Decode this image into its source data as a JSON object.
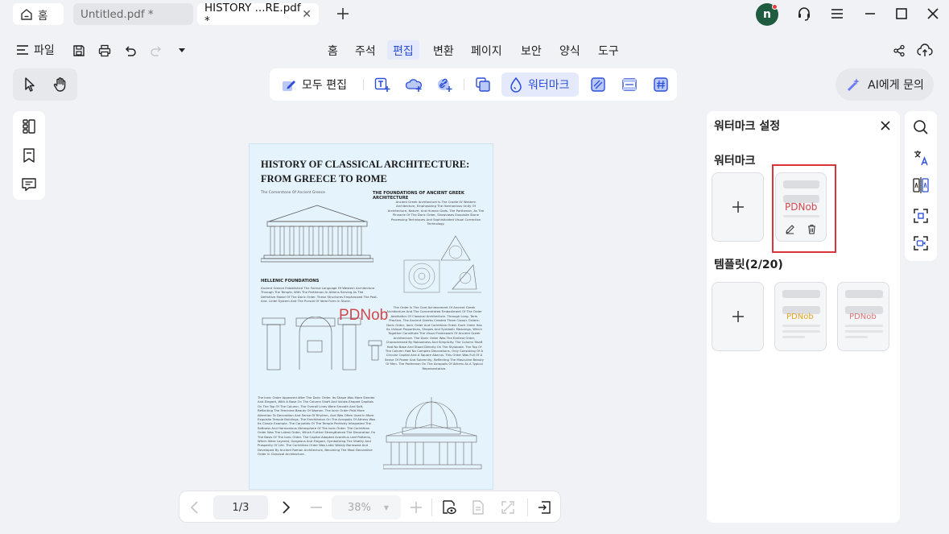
{
  "tabs": [
    {
      "label": "홈"
    },
    {
      "label": "Untitled.pdf *"
    },
    {
      "label": "HISTORY ...RE.pdf *"
    }
  ],
  "user": {
    "initial": "n"
  },
  "menu": {
    "file_label": "파일",
    "items": [
      "홈",
      "주석",
      "편집",
      "변환",
      "페이지",
      "보안",
      "양식",
      "도구"
    ],
    "active": "편집"
  },
  "edit_toolbar": {
    "edit_all_label": "모두 편집",
    "watermark_label": "워터마크"
  },
  "ai_button": {
    "label": "AI에게 문의"
  },
  "document": {
    "title": "HISTORY OF CLASSICAL  ARCHITECTURE: FROM GREECE TO ROME",
    "subtitle": "The Cornerstone Of Ancient Greece",
    "section1_heading": "THE FOUNDATIONS OF ANCIENT GREEK ARCHITECTURE",
    "section1_text": "Ancient Greek Architecture Is The Cradle Of Western Architecture, Emphasizing The Harmonious Unity Of Architecture, Nature, And Human Gods. The Parthenon, As The Pinnacle Of The Doric Order, Showcases Exquisite Stone Processing Techniques And Sophisticated Visual Correction Technology.",
    "section2_heading": "HELLENIC FOUNDATIONS",
    "section2_text": "Ancient Greece Established The Formal Language Of Western Architecture Through The Temple, With The Parthenon In Athens Serving As The Definitive Model Of The Doric Order. These Structures Emphasized The Post- And- Lintel System And The Pursuit Of Ideal Form In Stone.",
    "section3_text": "The Order Is The Core Achievement Of Ancient Greek Architecture And The Concentrated Embodiment Of The Order Aesthetics Of Classical Architecture. Through Long- Term Practice, The Ancient Greeks Created Three Classic Orders: Doric Order, Ionic Order And Corinthian Order. Each Order Has Its Unique Proportions, Shapes And Symbolic Meanings, Which Together Constitute The Visual Framework Of Ancient Greek Architecture. The Doric Order Was The Earliest Order, Characterized By Robustness And Simplicity. The Column Shaft Had No Base And Stood Directly On The Stylobate. The Top Of The Column Had No Complex Decorations, Only Consisting Of A Circular Capital And A Square Abacus. This Order Was Full Of A Sense Of Power And Solemnity, Reflecting The Masculine Beauty Of Men. The Parthenon On The Acropolis Of Athens As A Typical Representative.",
    "section4_text": "The Ionic Order Appeared After The Doric Order. Its Shape Was More Slender And Elegant, With A Base On The Column Shaft And Volute-Shaped Capitals On The Top Of The Column. The Overall Lines Were Smooth And Soft, Reflecting The Feminine Beauty Of Women. The Ionic Order Paid More Attention To Decoration And Sense Of Rhythm, And Was Often Used In More Exquisite Temple Buildings. The Erechtheion On The Acropolis Of Athens Was Its Classic Example. The Caryatids Of The Temple Perfectly Integrated The Softness And Harmonious Atmosphere Of The Ionic Order. The Corinthian Order Was The Latest Order, Which Further Strengthened The Decoration On The Basis Of The Ionic Order. The Capital Adopted Acanthus Leaf Patterns, Which Were Layered, Gorgeous And Elegant, Symbolizing The Vitality And Prosperity Of Life. The Corinthian Order Was Later Widely Borrowed And Developed By Ancient Roman Architecture, Becoming The Most Decorative Order In Classical Architecture.",
    "watermark_text": "PDNob"
  },
  "navigation": {
    "page_indicator": "1/3",
    "zoom": "38%"
  },
  "watermark_panel": {
    "title": "워터마크 설정",
    "watermark_section": "워터마크",
    "template_section": "템플릿(2/20)",
    "watermark_card_text": "PDNob",
    "template_cards": [
      {
        "text": "PDNob",
        "color": "#e0a520"
      },
      {
        "text": "PDNob",
        "color": "#d97575"
      }
    ]
  },
  "colors": {
    "accent": "#2d4fd8",
    "selection": "#d9343a",
    "watermark_red": "#d0474e"
  }
}
